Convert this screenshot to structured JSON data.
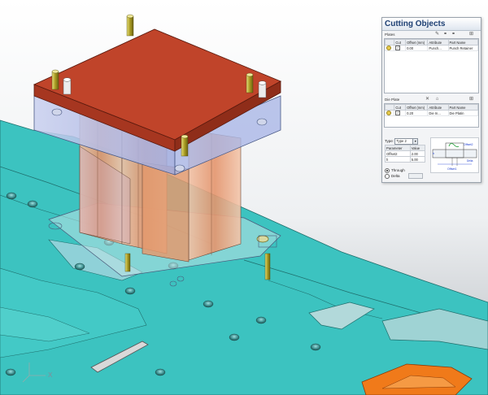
{
  "panel": {
    "title": "Cutting Objects",
    "plates_header": "Plates",
    "columns": [
      "Cut",
      "Offset (mm)",
      "Attribute",
      "Part Name"
    ],
    "plates_rows": [
      {
        "cut": "✓",
        "offset": "0.00",
        "attribute": "Punch...",
        "part_name": "Punch Retainer"
      }
    ],
    "die_header": "Die Plate",
    "die_rows": [
      {
        "cut": "✓",
        "offset": "0.20",
        "attribute": "Die In...",
        "part_name": "Die Platin"
      }
    ],
    "type_label": "Type:",
    "type_value": "Type 2",
    "param_headers": [
      "Parameter",
      "Value"
    ],
    "params": [
      {
        "name": "Offset2",
        "value": "2.00"
      },
      {
        "name": "h",
        "value": "5.00"
      }
    ],
    "radio_through": "Through",
    "radio_delta": "Delta",
    "diagram_offset1": "Offset1",
    "diagram_offset2": "Offset2",
    "diagram_h": "h",
    "diagram_delta": "Delta"
  },
  "viewport": {
    "axis_x": "X",
    "colors": {
      "strip": "#3cc3c0",
      "plate_top": "#c0442a",
      "plate_glass": "#aab6e6",
      "punch": "#e8a27e",
      "pin": "#c8c03a",
      "hole": "#2f6f6d",
      "orange_part": "#f07a1a"
    }
  },
  "icons": {
    "plates_tools": [
      "pencil-icon",
      "link-icon",
      "add-part-icon"
    ],
    "die_tools": [
      "delete-icon",
      "up-icon",
      "add-part-icon"
    ]
  }
}
